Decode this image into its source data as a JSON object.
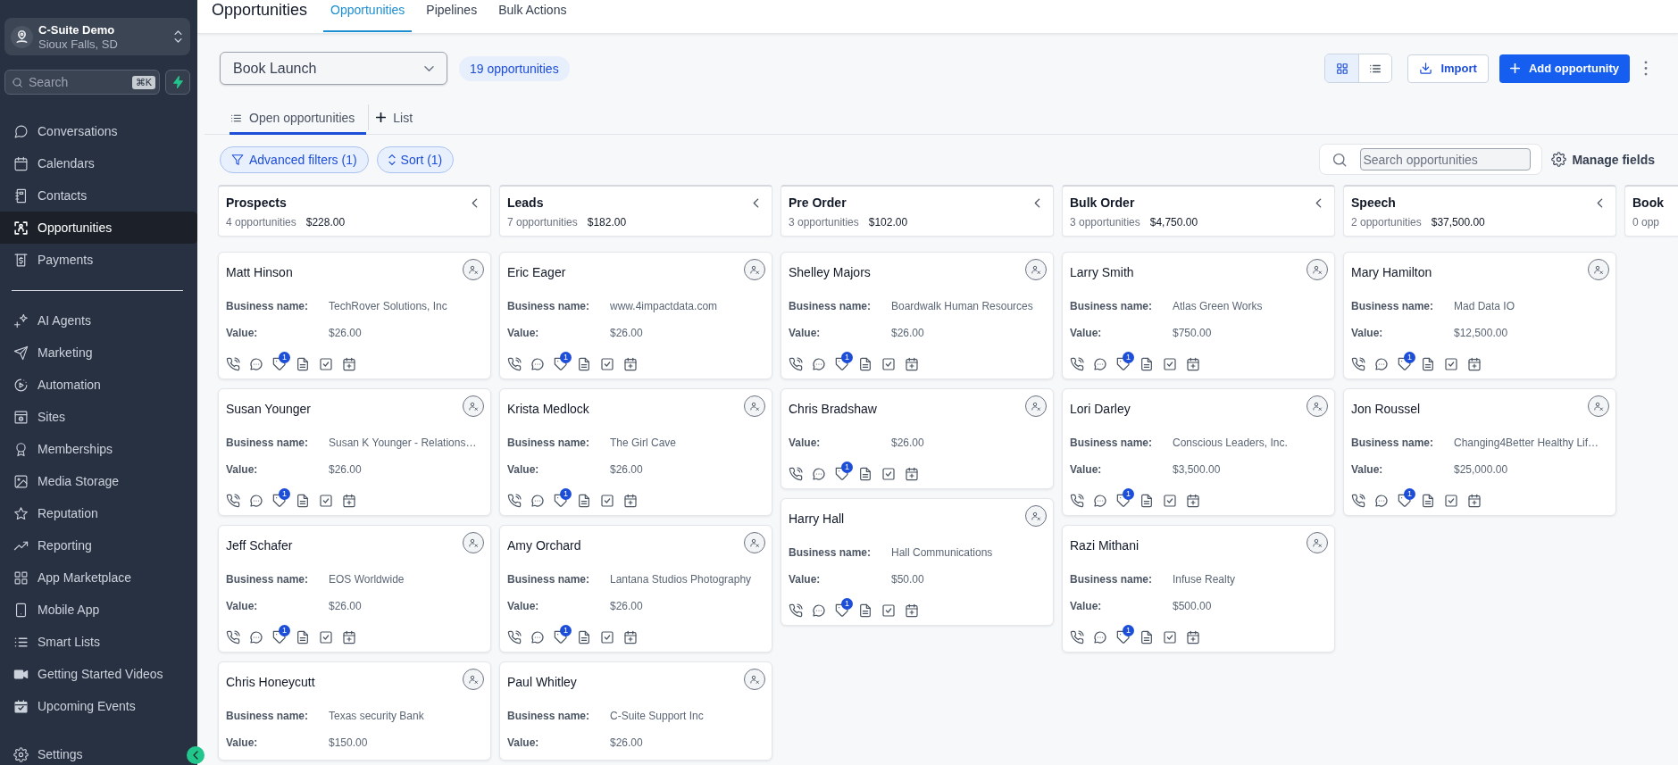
{
  "sidebar": {
    "account": {
      "name": "C-Suite Demo",
      "location": "Sioux Falls, SD"
    },
    "search": {
      "placeholder": "Search",
      "shortcut": "⌘K"
    },
    "nav_sections": [
      {
        "items": [
          {
            "label": "Conversations",
            "selected": false
          },
          {
            "label": "Calendars",
            "selected": false
          },
          {
            "label": "Contacts",
            "selected": false
          },
          {
            "label": "Opportunities",
            "selected": true
          },
          {
            "label": "Payments",
            "selected": false
          }
        ]
      },
      {
        "items": [
          {
            "label": "AI Agents",
            "selected": false
          },
          {
            "label": "Marketing",
            "selected": false
          },
          {
            "label": "Automation",
            "selected": false
          },
          {
            "label": "Sites",
            "selected": false
          },
          {
            "label": "Memberships",
            "selected": false
          },
          {
            "label": "Media Storage",
            "selected": false
          },
          {
            "label": "Reputation",
            "selected": false
          },
          {
            "label": "Reporting",
            "selected": false
          },
          {
            "label": "App Marketplace",
            "selected": false
          },
          {
            "label": "Mobile App",
            "selected": false
          },
          {
            "label": "Smart Lists",
            "selected": false
          },
          {
            "label": "Getting Started Videos",
            "selected": false
          },
          {
            "label": "Upcoming Events",
            "selected": false
          }
        ]
      }
    ],
    "settings": {
      "label": "Settings",
      "selected": false
    }
  },
  "header": {
    "title": "Opportunities",
    "tabs": [
      {
        "label": "Opportunities",
        "selected": true
      },
      {
        "label": "Pipelines",
        "selected": false
      },
      {
        "label": "Bulk Actions",
        "selected": false
      }
    ]
  },
  "toolbar": {
    "pipeline": {
      "value": "Book Launch"
    },
    "count_badge": "19 opportunities",
    "view_toggle": [
      {
        "kind": "grid",
        "selected": true
      },
      {
        "kind": "list",
        "selected": false
      }
    ],
    "import_button": "Import",
    "add_button": "Add opportunity"
  },
  "list_tabs": {
    "tabs": [
      {
        "label": "Open opportunities",
        "selected": true
      }
    ],
    "add_list": "List"
  },
  "filters": {
    "advanced_filters": "Advanced filters (1)",
    "sort": "Sort (1)",
    "search": {
      "placeholder": "Search opportunities"
    },
    "manage_fields": "Manage fields"
  },
  "board": {
    "columns": [
      {
        "name": "Prospects",
        "count": "4 opportunities",
        "total": "$228.00",
        "cut_off": false,
        "cards": [
          {
            "name": "Matt Hinson",
            "fields": [
              {
                "label": "Business name:",
                "value": "TechRover Solutions, Inc"
              },
              {
                "label": "Value:",
                "value": "$26.00"
              }
            ],
            "actions": {
              "tag_count": "1"
            }
          },
          {
            "name": "Susan Younger",
            "fields": [
              {
                "label": "Business name:",
                "value": "Susan K Younger - Relations…"
              },
              {
                "label": "Value:",
                "value": "$26.00"
              }
            ],
            "actions": {
              "tag_count": "1"
            }
          },
          {
            "name": "Jeff Schafer",
            "fields": [
              {
                "label": "Business name:",
                "value": "EOS Worldwide"
              },
              {
                "label": "Value:",
                "value": "$26.00"
              }
            ],
            "actions": {
              "tag_count": "1"
            }
          },
          {
            "name": "Chris Honeycutt",
            "fields": [
              {
                "label": "Business name:",
                "value": "Texas security Bank"
              },
              {
                "label": "Value:",
                "value": "$150.00"
              }
            ]
          }
        ]
      },
      {
        "name": "Leads",
        "count": "7 opportunities",
        "total": "$182.00",
        "cut_off": false,
        "cards": [
          {
            "name": "Eric Eager",
            "fields": [
              {
                "label": "Business name:",
                "value": "www.4impactdata.com"
              },
              {
                "label": "Value:",
                "value": "$26.00"
              }
            ],
            "actions": {
              "tag_count": "1"
            }
          },
          {
            "name": "Krista Medlock",
            "fields": [
              {
                "label": "Business name:",
                "value": "The Girl Cave"
              },
              {
                "label": "Value:",
                "value": "$26.00"
              }
            ],
            "actions": {
              "tag_count": "1"
            }
          },
          {
            "name": "Amy Orchard",
            "fields": [
              {
                "label": "Business name:",
                "value": "Lantana Studios Photography"
              },
              {
                "label": "Value:",
                "value": "$26.00"
              }
            ],
            "actions": {
              "tag_count": "1"
            }
          },
          {
            "name": "Paul Whitley",
            "fields": [
              {
                "label": "Business name:",
                "value": "C-Suite Support Inc"
              },
              {
                "label": "Value:",
                "value": "$26.00"
              }
            ]
          }
        ]
      },
      {
        "name": "Pre Order",
        "count": "3 opportunities",
        "total": "$102.00",
        "cut_off": false,
        "cards": [
          {
            "name": "Shelley Majors",
            "fields": [
              {
                "label": "Business name:",
                "value": "Boardwalk Human Resources"
              },
              {
                "label": "Value:",
                "value": "$26.00"
              }
            ],
            "actions": {
              "tag_count": "1"
            }
          },
          {
            "name": "Chris Bradshaw",
            "fields": [
              {
                "label": "Value:",
                "value": "$26.00"
              }
            ],
            "actions": {
              "tag_count": "1"
            }
          },
          {
            "name": "Harry Hall",
            "fields": [
              {
                "label": "Business name:",
                "value": "Hall Communications"
              },
              {
                "label": "Value:",
                "value": "$50.00"
              }
            ],
            "actions": {
              "tag_count": "1"
            }
          }
        ]
      },
      {
        "name": "Bulk Order",
        "count": "3 opportunities",
        "total": "$4,750.00",
        "cut_off": false,
        "cards": [
          {
            "name": "Larry Smith",
            "fields": [
              {
                "label": "Business name:",
                "value": "Atlas Green Works"
              },
              {
                "label": "Value:",
                "value": "$750.00"
              }
            ],
            "actions": {
              "tag_count": "1"
            }
          },
          {
            "name": "Lori Darley",
            "fields": [
              {
                "label": "Business name:",
                "value": "Conscious Leaders, Inc."
              },
              {
                "label": "Value:",
                "value": "$3,500.00"
              }
            ],
            "actions": {
              "tag_count": "1"
            }
          },
          {
            "name": "Razi Mithani",
            "fields": [
              {
                "label": "Business name:",
                "value": "Infuse Realty"
              },
              {
                "label": "Value:",
                "value": "$500.00"
              }
            ],
            "actions": {
              "tag_count": "1"
            }
          }
        ]
      },
      {
        "name": "Speech",
        "count": "2 opportunities",
        "total": "$37,500.00",
        "cut_off": false,
        "cards": [
          {
            "name": "Mary Hamilton",
            "fields": [
              {
                "label": "Business name:",
                "value": "Mad Data IO"
              },
              {
                "label": "Value:",
                "value": "$12,500.00"
              }
            ],
            "actions": {
              "tag_count": "1"
            }
          },
          {
            "name": "Jon Roussel",
            "fields": [
              {
                "label": "Business name:",
                "value": "Changing4Better Healthy Lif…"
              },
              {
                "label": "Value:",
                "value": "$25,000.00"
              }
            ],
            "actions": {
              "tag_count": "1"
            }
          }
        ]
      },
      {
        "name": "Book",
        "count": "0 opp",
        "cut_off": true
      }
    ]
  }
}
